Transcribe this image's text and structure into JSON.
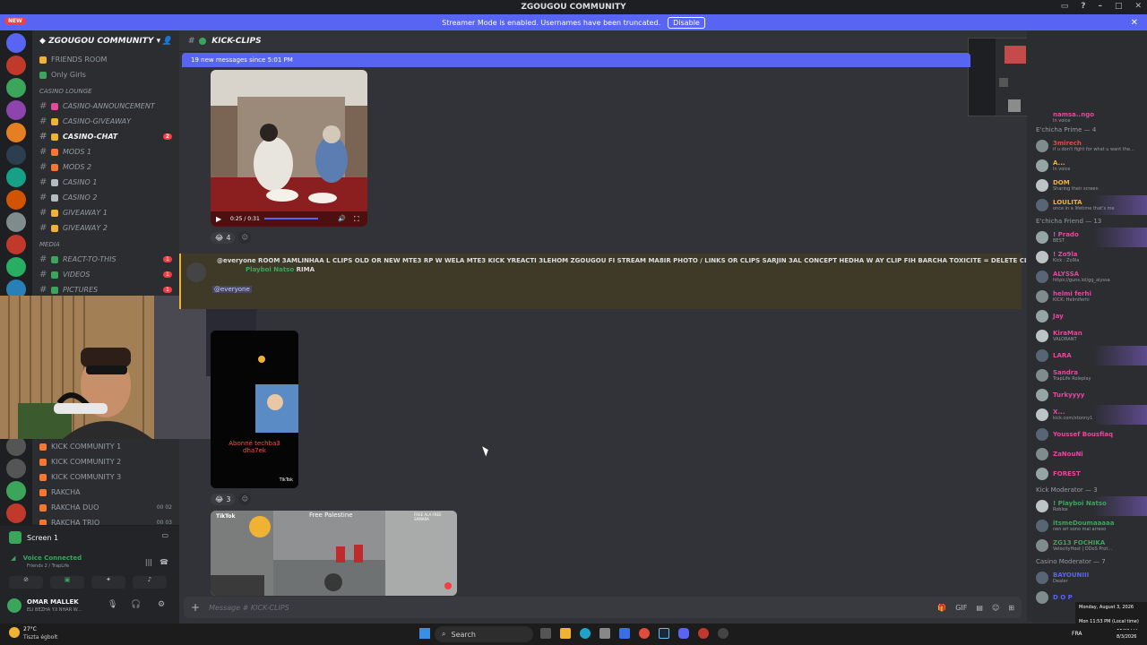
{
  "window": {
    "title": "ZGOUGOU COMMUNITY"
  },
  "banner": {
    "text": "Streamer Mode is enabled. Usernames have been truncated.",
    "button": "Disable"
  },
  "new_pill": "NEW",
  "guild": {
    "name": "ZGOUGOU COMMUNITY"
  },
  "channels": [
    {
      "name": "FRIENDS ROOM",
      "color": "#f0b232"
    },
    {
      "name": "Only Girls",
      "color": "#3ba55c"
    }
  ],
  "casino_category": "CASINO LOUNGE",
  "casino_channels": [
    {
      "name": "CASINO-ANNOUNCEMENT",
      "color": "#eb459e"
    },
    {
      "name": "CASINO-GIVEAWAY",
      "color": "#f0b232"
    },
    {
      "name": "CASINO-CHAT",
      "color": "#f0b232",
      "active": true,
      "badge": "2"
    },
    {
      "name": "MODS 1",
      "color": "#f57731"
    },
    {
      "name": "MODS 2",
      "color": "#f57731"
    },
    {
      "name": "CASINO 1",
      "color": "#b5bac1"
    },
    {
      "name": "CASINO 2",
      "color": "#b5bac1"
    },
    {
      "name": "GIVEAWAY 1",
      "color": "#f0b232"
    },
    {
      "name": "GIVEAWAY 2",
      "color": "#f0b232"
    }
  ],
  "media_category": "MEDIA",
  "media_channels": [
    {
      "name": "REACT-TO-THIS",
      "badge": "1"
    },
    {
      "name": "VIDEOS",
      "badge": "1"
    },
    {
      "name": "PICTURES",
      "badge": "1"
    }
  ],
  "voice_channels": [
    {
      "name": "KICK COMMUNITY 1"
    },
    {
      "name": "KICK COMMUNITY 2"
    },
    {
      "name": "KICK COMMUNITY 3"
    },
    {
      "name": "RAKCHA"
    },
    {
      "name": "RAKCHA DUO",
      "meta": "00 02"
    },
    {
      "name": "RAKCHA TRIO",
      "meta": "00 03"
    }
  ],
  "screen": {
    "label": "Screen 1"
  },
  "voice": {
    "status": "Voice Connected",
    "sub": "Friends 2 / TrapLife"
  },
  "user": {
    "name": "OMAR MALLEK",
    "status": "ELI BEZHA Y.ll NHAR W..."
  },
  "channel_header": {
    "name": "KICK-CLIPS"
  },
  "new_messages": "19 new messages since 5:01 PM",
  "video1": {
    "time": "0:25 / 0:31"
  },
  "reaction1": {
    "emoji": "😂",
    "count": "4"
  },
  "announce": {
    "text": "@everyone ROOM 3AMLINHAA L CLIPS OLD OR NEW MTE3 RP W WELA MTE3 KICK YREACTI 3LEHOM ZGOUGOU FI STREAM   MA8IR PHOTO / LINKS OR CLIPS SARJIN 3AL CONCEPT HEDHA W AY CLIP FIH BARCHA TOXICITE = DELETE CLIP AY CLIPS FIH ...",
    "author": "Playboi Natso",
    "tag": "RIMA",
    "mention": "@everyone"
  },
  "video2": {
    "caption": "Abonné techba3 dha7ek",
    "brand": "TikTok"
  },
  "reaction2": {
    "emoji": "😂",
    "count": "3"
  },
  "video3": {
    "caption": "Free Palestine",
    "corner": "FREE ALA FREE SAMARA",
    "brand": "TikTok"
  },
  "message_input": {
    "placeholder": "Message # KICK-CLIPS"
  },
  "members": {
    "top_cut": "namsa..ngo",
    "top_cut_status": "In voice",
    "sections": [
      {
        "title": "E'chicha Prime — 4",
        "items": [
          {
            "name": "3mirech",
            "status": "if u don't fight for what u want the...",
            "color": "#ed4245"
          },
          {
            "name": "A...",
            "status": "In voice",
            "color": "#f0b232"
          },
          {
            "name": "DOM",
            "status": "Sharing their screen",
            "color": "#f0b232"
          },
          {
            "name": "LOULITA",
            "status": "once in a lifetime that's me",
            "color": "#f0b232",
            "hl": true
          }
        ]
      },
      {
        "title": "E'chicha Friend — 13",
        "items": [
          {
            "name": "! Prado",
            "status": "BEST",
            "color": "#eb459e",
            "hl": true
          },
          {
            "name": "! Zo9la",
            "status": "Kick : Zo9la",
            "color": "#eb459e"
          },
          {
            "name": "ALYSSA",
            "status": "https://guns.lol/gg_alyssa",
            "color": "#eb459e"
          },
          {
            "name": "helmi ferhi",
            "status": "KICK: Helmiferhi",
            "color": "#eb459e"
          },
          {
            "name": "Jay",
            "status": "",
            "color": "#eb459e"
          },
          {
            "name": "KiraMan",
            "status": "VALORANT",
            "color": "#eb459e"
          },
          {
            "name": "LARA",
            "status": "",
            "color": "#eb459e",
            "hl": true
          },
          {
            "name": "Sandra",
            "status": "TrapLife Roleplay",
            "color": "#eb459e"
          },
          {
            "name": "Turkyyyy",
            "status": "",
            "color": "#eb459e"
          },
          {
            "name": "X...",
            "status": "kick.com/xtonny1",
            "color": "#eb459e",
            "hl": true
          },
          {
            "name": "Youssef Bousfiaq",
            "status": "",
            "color": "#eb459e"
          },
          {
            "name": "ZaNouNi",
            "status": "",
            "color": "#eb459e"
          },
          {
            "name": "FOREST",
            "status": "",
            "color": "#eb459e"
          }
        ]
      },
      {
        "title": "Kick Moderator — 3",
        "items": [
          {
            "name": "! Playboi Natso",
            "status": "Roblox",
            "color": "#3ba55c",
            "hl": true
          },
          {
            "name": "itsmeDoumaaaaa",
            "status": "nen eri sono mai arreso",
            "color": "#3ba55c"
          },
          {
            "name": "ZG13 FOCHIKA",
            "status": "VelocityHost | DDoS Prot...",
            "color": "#3ba55c"
          }
        ]
      },
      {
        "title": "Casino Moderator — 7",
        "items": [
          {
            "name": "BAYOUNIII",
            "status": "Dealer",
            "color": "#5865f2"
          },
          {
            "name": "D O P",
            "status": "",
            "color": "#5865f2"
          }
        ]
      }
    ]
  },
  "taskbar": {
    "weather_temp": "27°C",
    "weather_desc": "Tiszta égbolt",
    "search": "Search",
    "lang": "FRA",
    "date_tip": "Monday, August 3, 2026",
    "time_tip": "Mon 11:53 PM (Local time)",
    "time": "11:53 PM",
    "date": "8/3/2026"
  },
  "colors": {
    "accent": "#5865f2",
    "danger": "#f23f43",
    "bg": "#313338",
    "sidebar": "#2b2d31"
  }
}
